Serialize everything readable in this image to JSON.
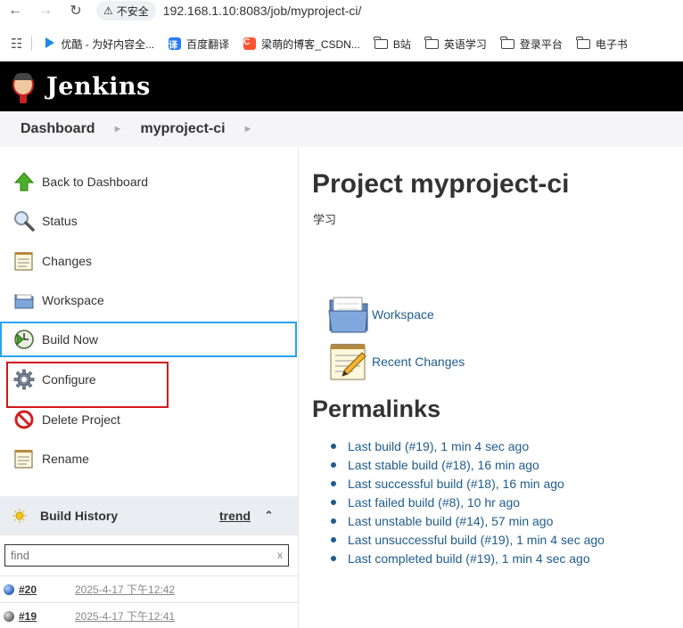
{
  "browser": {
    "security_label": "不安全",
    "url": "192.168.1.10:8083/job/myproject-ci/",
    "bookmarks": [
      {
        "label": "优酷 - 为好内容全...",
        "icon": "youku-icon",
        "color": "#1e88e5"
      },
      {
        "label": "百度翻译",
        "icon": "baidu-translate-icon",
        "color": "#2a7cf6"
      },
      {
        "label": "梁萌的博客_CSDN...",
        "icon": "csdn-icon",
        "color": "#fc5531"
      },
      {
        "label": "B站",
        "icon": "folder-icon"
      },
      {
        "label": "英语学习",
        "icon": "folder-icon"
      },
      {
        "label": "登录平台",
        "icon": "folder-icon"
      },
      {
        "label": "电子书",
        "icon": "folder-icon"
      }
    ]
  },
  "header": {
    "title": "Jenkins"
  },
  "breadcrumb": {
    "items": [
      "Dashboard",
      "myproject-ci"
    ]
  },
  "tasks": [
    {
      "label": "Back to Dashboard",
      "icon": "up-arrow-icon"
    },
    {
      "label": "Status",
      "icon": "magnifier-icon"
    },
    {
      "label": "Changes",
      "icon": "notepad-icon"
    },
    {
      "label": "Workspace",
      "icon": "folder-icon"
    },
    {
      "label": "Build Now",
      "icon": "clock-play-icon"
    },
    {
      "label": "Configure",
      "icon": "gear-icon"
    },
    {
      "label": "Delete Project",
      "icon": "no-entry-icon"
    },
    {
      "label": "Rename",
      "icon": "notepad-icon"
    }
  ],
  "build_history": {
    "title": "Build History",
    "trend_label": "trend",
    "search_placeholder": "find",
    "search_clear": "x",
    "builds": [
      {
        "number": "#20",
        "date": "2025-4-17 下午12:42",
        "status": "blue"
      },
      {
        "number": "#19",
        "date": "2025-4-17 下午12:41",
        "status": "grey"
      }
    ]
  },
  "main": {
    "title": "Project myproject-ci",
    "description": "学习",
    "links": [
      {
        "label": "Workspace",
        "icon": "folder-icon"
      },
      {
        "label": "Recent Changes",
        "icon": "notepad-icon"
      }
    ],
    "permalinks_title": "Permalinks",
    "permalinks": [
      "Last build (#19), 1 min 4 sec ago",
      "Last stable build (#18), 16 min ago",
      "Last successful build (#18), 16 min ago",
      "Last failed build (#8), 10 hr ago",
      "Last unstable build (#14), 57 min ago",
      "Last unsuccessful build (#19), 1 min 4 sec ago",
      "Last completed build (#19), 1 min 4 sec ago"
    ]
  },
  "colors": {
    "link": "#1f5d8c",
    "header_bg": "#000000",
    "highlight_blue": "#2aa2ec",
    "highlight_red": "#d0191d"
  }
}
